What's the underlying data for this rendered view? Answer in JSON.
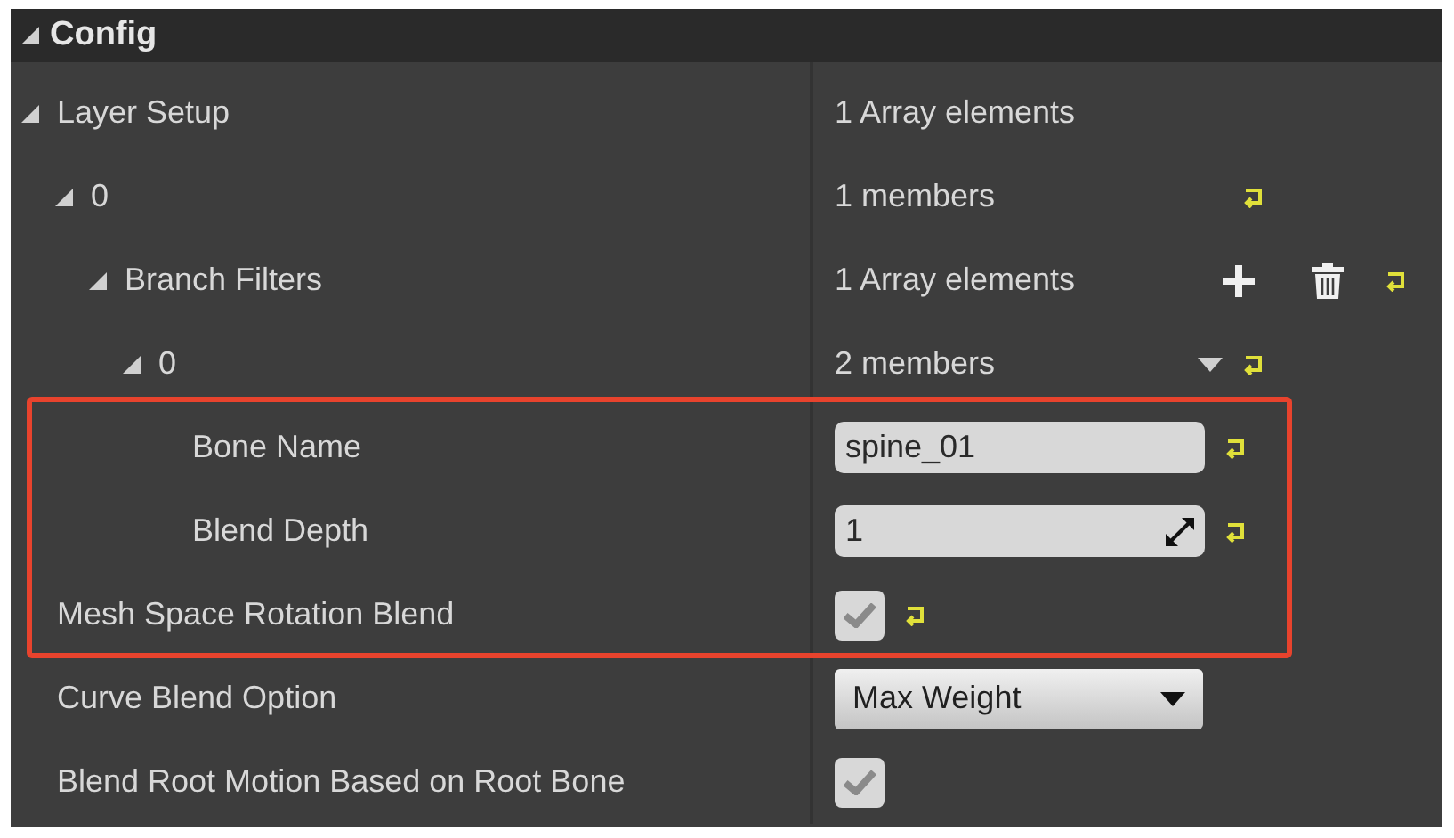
{
  "section": {
    "title": "Config",
    "expanded": true
  },
  "properties": [
    {
      "kind": "group",
      "label": "Layer Setup",
      "expanded": true,
      "value": "1 Array elements",
      "reset_button": false,
      "highlighted": false,
      "children": [
        {
          "kind": "group",
          "label": "0",
          "expanded": true,
          "value": "1 members",
          "reset_button": true,
          "highlighted": false,
          "children": [
            {
              "kind": "group",
              "label": "Branch Filters",
              "expanded": true,
              "value": "1 Array elements",
              "add_button": true,
              "delete_button": true,
              "reset_button": true,
              "highlighted": false,
              "children": [
                {
                  "kind": "group",
                  "label": "0",
                  "expanded": true,
                  "value": "2 members",
                  "menu_caret": true,
                  "reset_button": true,
                  "highlighted": false,
                  "children": [
                    {
                      "kind": "text",
                      "label": "Bone Name",
                      "value": "spine_01",
                      "reset_button": true,
                      "highlighted": true
                    },
                    {
                      "kind": "number",
                      "label": "Blend Depth",
                      "value": "1",
                      "reset_button": true,
                      "highlighted": true
                    }
                  ]
                }
              ]
            }
          ]
        }
      ]
    },
    {
      "kind": "checkbox",
      "label": "Mesh Space Rotation Blend",
      "checked": true,
      "reset_button": true,
      "highlighted": true
    },
    {
      "kind": "dropdown",
      "label": "Curve Blend Option",
      "value": "Max Weight",
      "reset_button": false,
      "highlighted": false
    },
    {
      "kind": "checkbox",
      "label": "Blend Root Motion Based on Root Bone",
      "checked": true,
      "reset_button": false,
      "highlighted": false
    }
  ]
}
